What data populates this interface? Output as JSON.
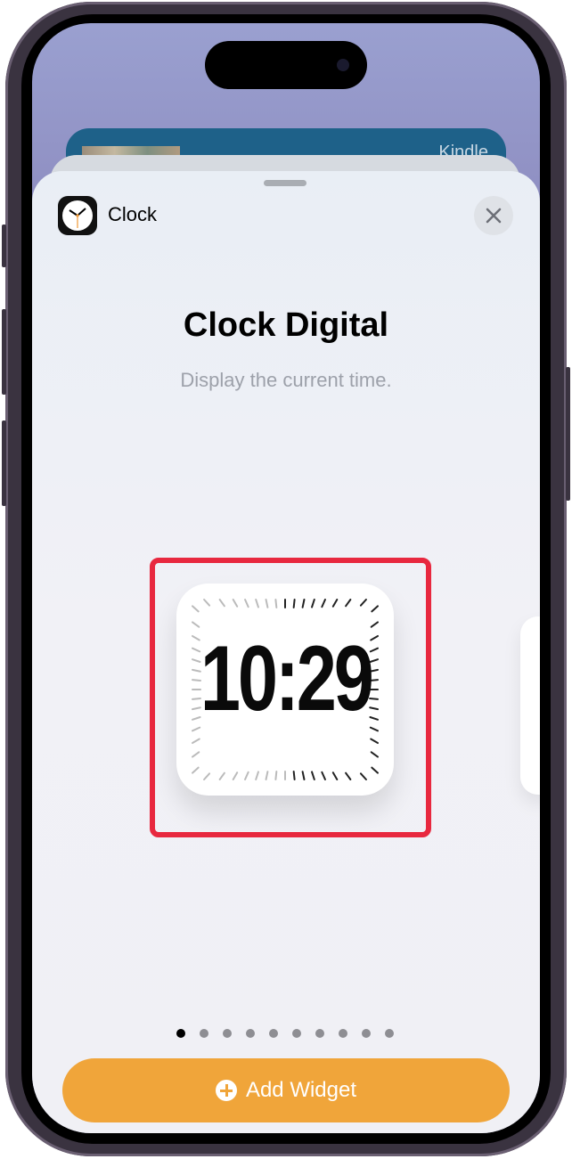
{
  "background_card": {
    "label": "Kindle"
  },
  "sheet": {
    "app_name": "Clock",
    "app_icon": "clock-icon",
    "close_icon": "close-icon",
    "title": "Clock Digital",
    "subtitle": "Display the current time.",
    "widget": {
      "time": "10:29",
      "highlighted": true,
      "highlight_color": "#e8283f"
    },
    "page_indicator": {
      "count": 10,
      "active_index": 0
    },
    "add_button": {
      "label": "Add Widget",
      "icon": "plus-circle-icon",
      "color": "#f0a53a"
    }
  }
}
